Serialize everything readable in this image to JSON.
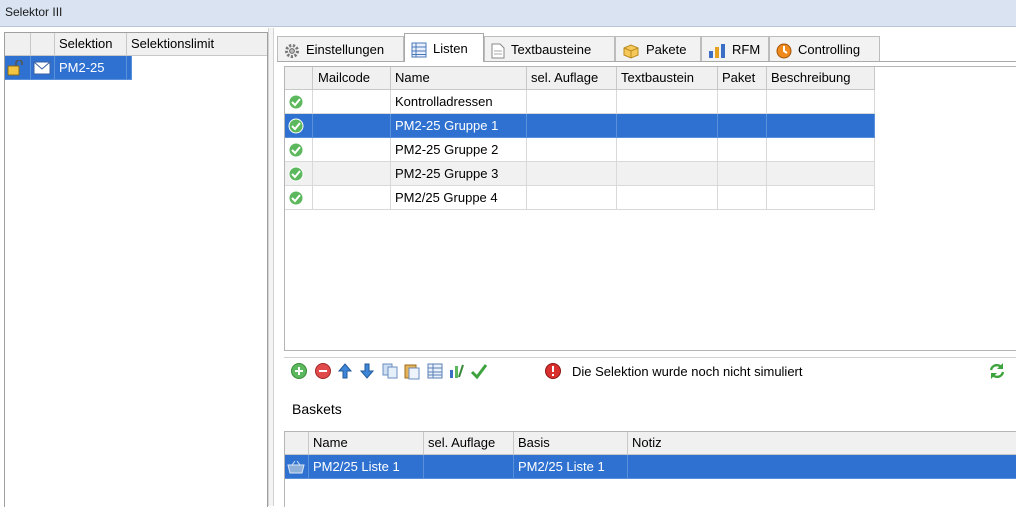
{
  "window": {
    "title": "Selektor III"
  },
  "left_table": {
    "headers": [
      "",
      "",
      "Selektion",
      "Selektionslimit"
    ],
    "rows": [
      {
        "selektion": "PM2-25",
        "limit": ""
      }
    ]
  },
  "tabs": [
    {
      "label": "Einstellungen",
      "icon": "gear-icon"
    },
    {
      "label": "Listen",
      "icon": "list-icon",
      "active": true
    },
    {
      "label": "Textbausteine",
      "icon": "document-icon"
    },
    {
      "label": "Pakete",
      "icon": "package-icon"
    },
    {
      "label": "RFM",
      "icon": "bar-chart-icon"
    },
    {
      "label": "Controlling",
      "icon": "controlling-icon"
    }
  ],
  "lists_table": {
    "headers": [
      "",
      "Mailcode",
      "Name",
      "sel. Auflage",
      "Textbaustein",
      "Paket",
      "Beschreibung"
    ],
    "rows": [
      {
        "mailcode": "",
        "name": "Kontrolladressen",
        "auflage": "",
        "textbaustein": "",
        "paket": "",
        "beschreibung": ""
      },
      {
        "mailcode": "",
        "name": "PM2-25 Gruppe 1",
        "auflage": "",
        "textbaustein": "",
        "paket": "",
        "beschreibung": ""
      },
      {
        "mailcode": "",
        "name": "PM2-25 Gruppe 2",
        "auflage": "",
        "textbaustein": "",
        "paket": "",
        "beschreibung": ""
      },
      {
        "mailcode": "",
        "name": "PM2-25 Gruppe 3",
        "auflage": "",
        "textbaustein": "",
        "paket": "",
        "beschreibung": ""
      },
      {
        "mailcode": "",
        "name": "PM2/25 Gruppe 4",
        "auflage": "",
        "textbaustein": "",
        "paket": "",
        "beschreibung": ""
      }
    ]
  },
  "toolbar": {
    "status": "Die Selektion wurde noch nicht simuliert",
    "icons": [
      "add-icon",
      "remove-icon",
      "move-up-icon",
      "move-down-icon",
      "copy-icon",
      "paste-icon",
      "table-icon",
      "chart-icon",
      "check-icon",
      "warning-icon",
      "refresh-icon"
    ]
  },
  "baskets": {
    "label": "Baskets",
    "headers": [
      "",
      "Name",
      "sel. Auflage",
      "Basis",
      "Notiz"
    ],
    "rows": [
      {
        "name": "PM2/25 Liste 1",
        "auflage": "",
        "basis": "PM2/25 Liste 1",
        "notiz": ""
      }
    ]
  },
  "colors": {
    "selection": "#2f71d0",
    "title_bar": "#d9e3f2",
    "ok_green": "#5cb85c"
  }
}
